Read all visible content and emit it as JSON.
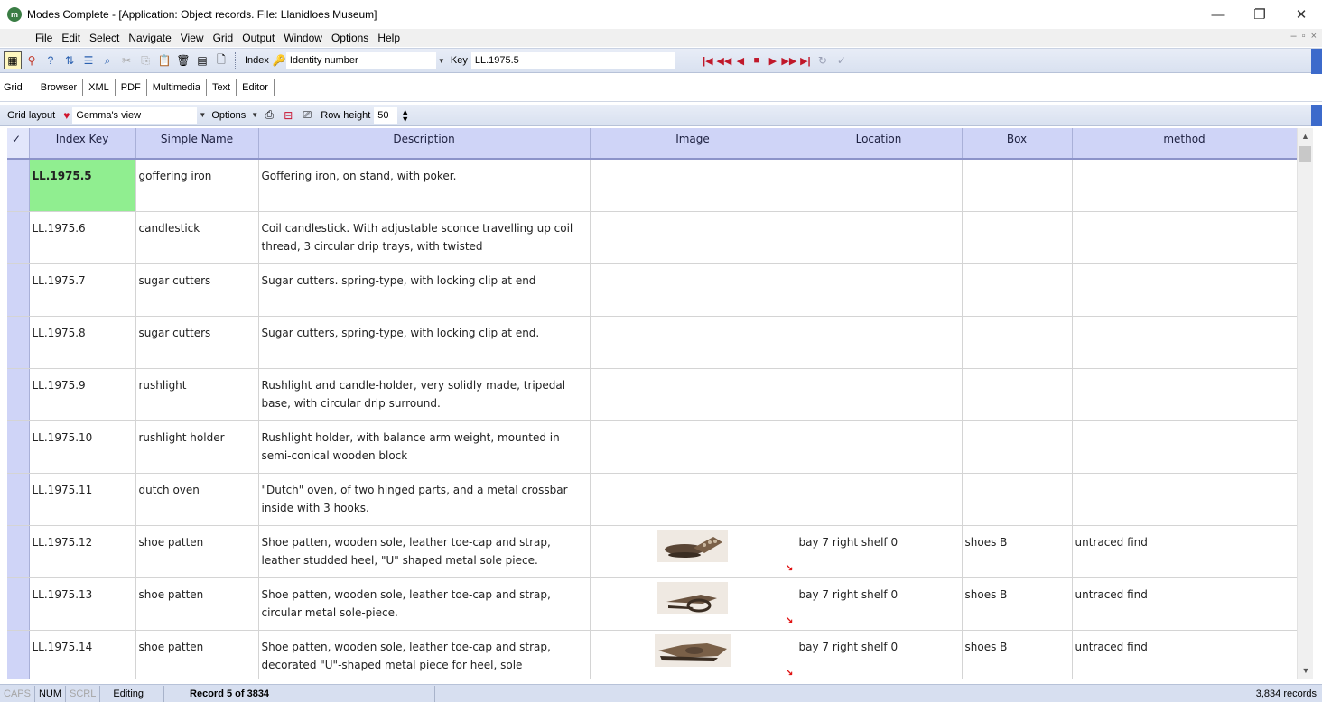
{
  "window": {
    "title": "Modes Complete - [Application: Object records. File: Llanidloes Museum]",
    "app_icon_text": "m",
    "minimize": "—",
    "restore": "❐",
    "close": "✕"
  },
  "menu": {
    "items": [
      "File",
      "Edit",
      "Select",
      "Navigate",
      "View",
      "Grid",
      "Output",
      "Window",
      "Options",
      "Help"
    ],
    "mdi_controls": [
      "–",
      "▫",
      "×"
    ]
  },
  "toolbar": {
    "index_label": "Index",
    "index_value": "Identity number",
    "key_label": "Key",
    "key_value": "LL.1975.5"
  },
  "view_tabs": [
    "Grid",
    "Browser",
    "XML",
    "PDF",
    "Multimedia",
    "Text",
    "Editor"
  ],
  "gridbar": {
    "layout_label": "Grid layout",
    "layout_value": "Gemma's view",
    "options_label": "Options",
    "row_height_label": "Row height",
    "row_height_value": "50"
  },
  "grid": {
    "checkmark": "✓",
    "columns": [
      "Index Key",
      "Simple Name",
      "Description",
      "Image",
      "Location",
      "Box",
      "method"
    ],
    "rows": [
      {
        "key": "LL.1975.5",
        "name": "goffering iron",
        "description": "Goffering iron, on stand, with poker.",
        "location": "",
        "box": "",
        "method": ""
      },
      {
        "key": "LL.1975.6",
        "name": "candlestick",
        "description": "Coil candlestick. With adjustable sconce travelling up coil thread, 3 circular drip trays, with twisted",
        "location": "",
        "box": "",
        "method": ""
      },
      {
        "key": "LL.1975.7",
        "name": "sugar cutters",
        "description": "Sugar cutters. spring-type, with locking clip at end",
        "location": "",
        "box": "",
        "method": ""
      },
      {
        "key": "LL.1975.8",
        "name": "sugar cutters",
        "description": "Sugar cutters, spring-type, with locking clip at end.",
        "location": "",
        "box": "",
        "method": ""
      },
      {
        "key": "LL.1975.9",
        "name": "rushlight",
        "description": "Rushlight and candle-holder, very solidly made, tripedal base, with circular drip surround.",
        "location": "",
        "box": "",
        "method": ""
      },
      {
        "key": "LL.1975.10",
        "name": "rushlight holder",
        "description": "Rushlight holder, with balance arm weight, mounted in semi-conical wooden block",
        "location": "",
        "box": "",
        "method": ""
      },
      {
        "key": "LL.1975.11",
        "name": "dutch oven",
        "description": "\"Dutch\" oven, of two hinged parts, and a metal crossbar inside with 3 hooks.",
        "location": "",
        "box": "",
        "method": ""
      },
      {
        "key": "LL.1975.12",
        "name": "shoe patten",
        "description": "Shoe patten, wooden sole, leather toe-cap and strap, leather studded heel, \"U\" shaped metal sole piece.",
        "location": "bay 7 right shelf 0",
        "box": "shoes B",
        "method": "untraced find"
      },
      {
        "key": "LL.1975.13",
        "name": "shoe patten",
        "description": "Shoe patten, wooden sole, leather toe-cap and strap, circular metal sole-piece.",
        "location": "bay 7 right shelf 0",
        "box": "shoes B",
        "method": "untraced find"
      },
      {
        "key": "LL.1975.14",
        "name": "shoe patten",
        "description": "Shoe patten, wooden sole, leather toe-cap and strap, decorated \"U\"-shaped metal piece for heel, sole",
        "location": "bay 7 right shelf 0",
        "box": "shoes B",
        "method": "untraced find"
      }
    ]
  },
  "status": {
    "caps": "CAPS",
    "num": "NUM",
    "scrl": "SCRL",
    "mode": "Editing",
    "record": "Record 5 of 3834",
    "total": "3,834 records"
  },
  "colors": {
    "header_bg": "#cfd4f7",
    "active_cell": "#90ee90",
    "toolbar_accent": "#3c6acb",
    "nav_red": "#c0182a"
  }
}
